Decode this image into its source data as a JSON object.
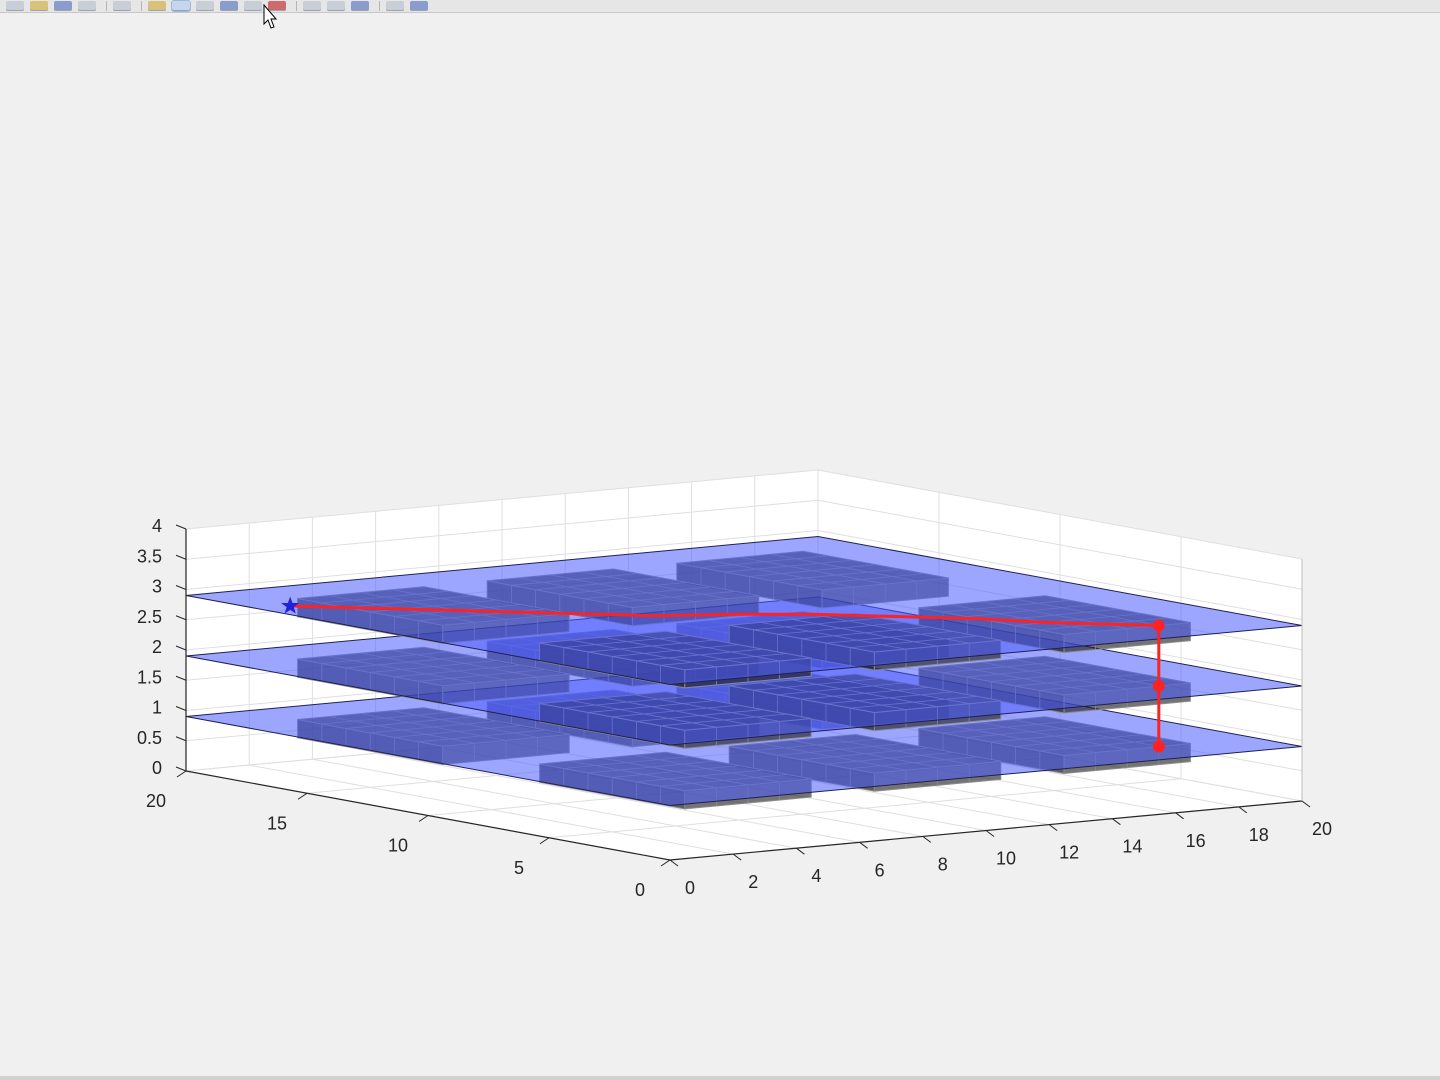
{
  "toolbar": {
    "icons": [
      "new-figure-icon",
      "open-icon",
      "save-icon",
      "print-icon",
      "edit-plot-icon",
      "insert-icon",
      "zoom-in-icon",
      "zoom-out-icon",
      "pan-icon",
      "rotate-3d-icon",
      "data-cursor-icon",
      "brush-icon",
      "link-icon",
      "colorbar-icon",
      "legend-icon",
      "hide-tools-icon",
      "dock-icon"
    ]
  },
  "colors": {
    "plane": "#4d5cff",
    "plane_edge": "#1f2050",
    "obstacle_face": "#1e1e1e",
    "obstacle_edge": "#8c8c8c",
    "path": "#ff2222",
    "start_marker": "#2222dd"
  },
  "chart_data": {
    "type": "3d-scatter-path",
    "title": "",
    "xlabel": "",
    "ylabel": "",
    "zlabel": "",
    "xlim": [
      0,
      20
    ],
    "ylim": [
      0,
      20
    ],
    "zlim": [
      0,
      4
    ],
    "grid": true,
    "box": true,
    "x_ticks": [
      "0",
      "2",
      "4",
      "6",
      "8",
      "10",
      "12",
      "14",
      "16",
      "18",
      "20"
    ],
    "y_ticks": [
      "0",
      "5",
      "10",
      "15",
      "20"
    ],
    "z_ticks": [
      "0",
      "0.5",
      "1",
      "1.5",
      "2",
      "2.5",
      "3",
      "3.5",
      "4"
    ],
    "layer_planes_z": [
      0.9,
      1.9,
      2.9
    ],
    "obstacle_blocks": [
      {
        "x": [
          2,
          6
        ],
        "y": [
          2,
          8
        ]
      },
      {
        "x": [
          8,
          12
        ],
        "y": [
          2,
          8
        ]
      },
      {
        "x": [
          14,
          18
        ],
        "y": [
          2,
          8
        ]
      },
      {
        "x": [
          2,
          6
        ],
        "y": [
          12,
          18
        ]
      },
      {
        "x": [
          8,
          12
        ],
        "y": [
          12,
          18
        ]
      },
      {
        "x": [
          14,
          18
        ],
        "y": [
          12,
          18
        ]
      }
    ],
    "obstacle_layers": [
      {
        "z": [
          0.6,
          0.9
        ],
        "blocks": [
          0,
          1,
          2,
          3,
          4,
          5
        ]
      },
      {
        "z": [
          1.6,
          1.9
        ],
        "blocks": [
          0,
          1,
          2,
          3,
          4,
          5
        ]
      },
      {
        "z": [
          2.6,
          2.9
        ],
        "blocks": [
          0,
          1,
          2,
          3,
          4,
          5
        ]
      }
    ],
    "path": {
      "x": [
        1,
        2,
        3.5,
        5,
        6.5,
        7.5,
        9.5,
        11,
        12.5,
        14,
        15,
        16,
        17,
        17,
        17,
        17
      ],
      "y": [
        17,
        16,
        14.5,
        13,
        11.5,
        10.5,
        9.5,
        8.5,
        7,
        5.5,
        4,
        3,
        2,
        2,
        2,
        2
      ],
      "z": [
        2.9,
        2.9,
        2.9,
        2.9,
        2.9,
        2.9,
        2.9,
        2.9,
        2.9,
        2.9,
        2.9,
        2.9,
        2.9,
        2.9,
        1.9,
        0.9
      ]
    },
    "start_marker": {
      "x": 1,
      "y": 17,
      "z": 2.9
    },
    "waypoints": [
      {
        "x": 17,
        "y": 2,
        "z": 2.9
      },
      {
        "x": 17,
        "y": 2,
        "z": 1.9
      },
      {
        "x": 17,
        "y": 2,
        "z": 0.9
      }
    ]
  }
}
